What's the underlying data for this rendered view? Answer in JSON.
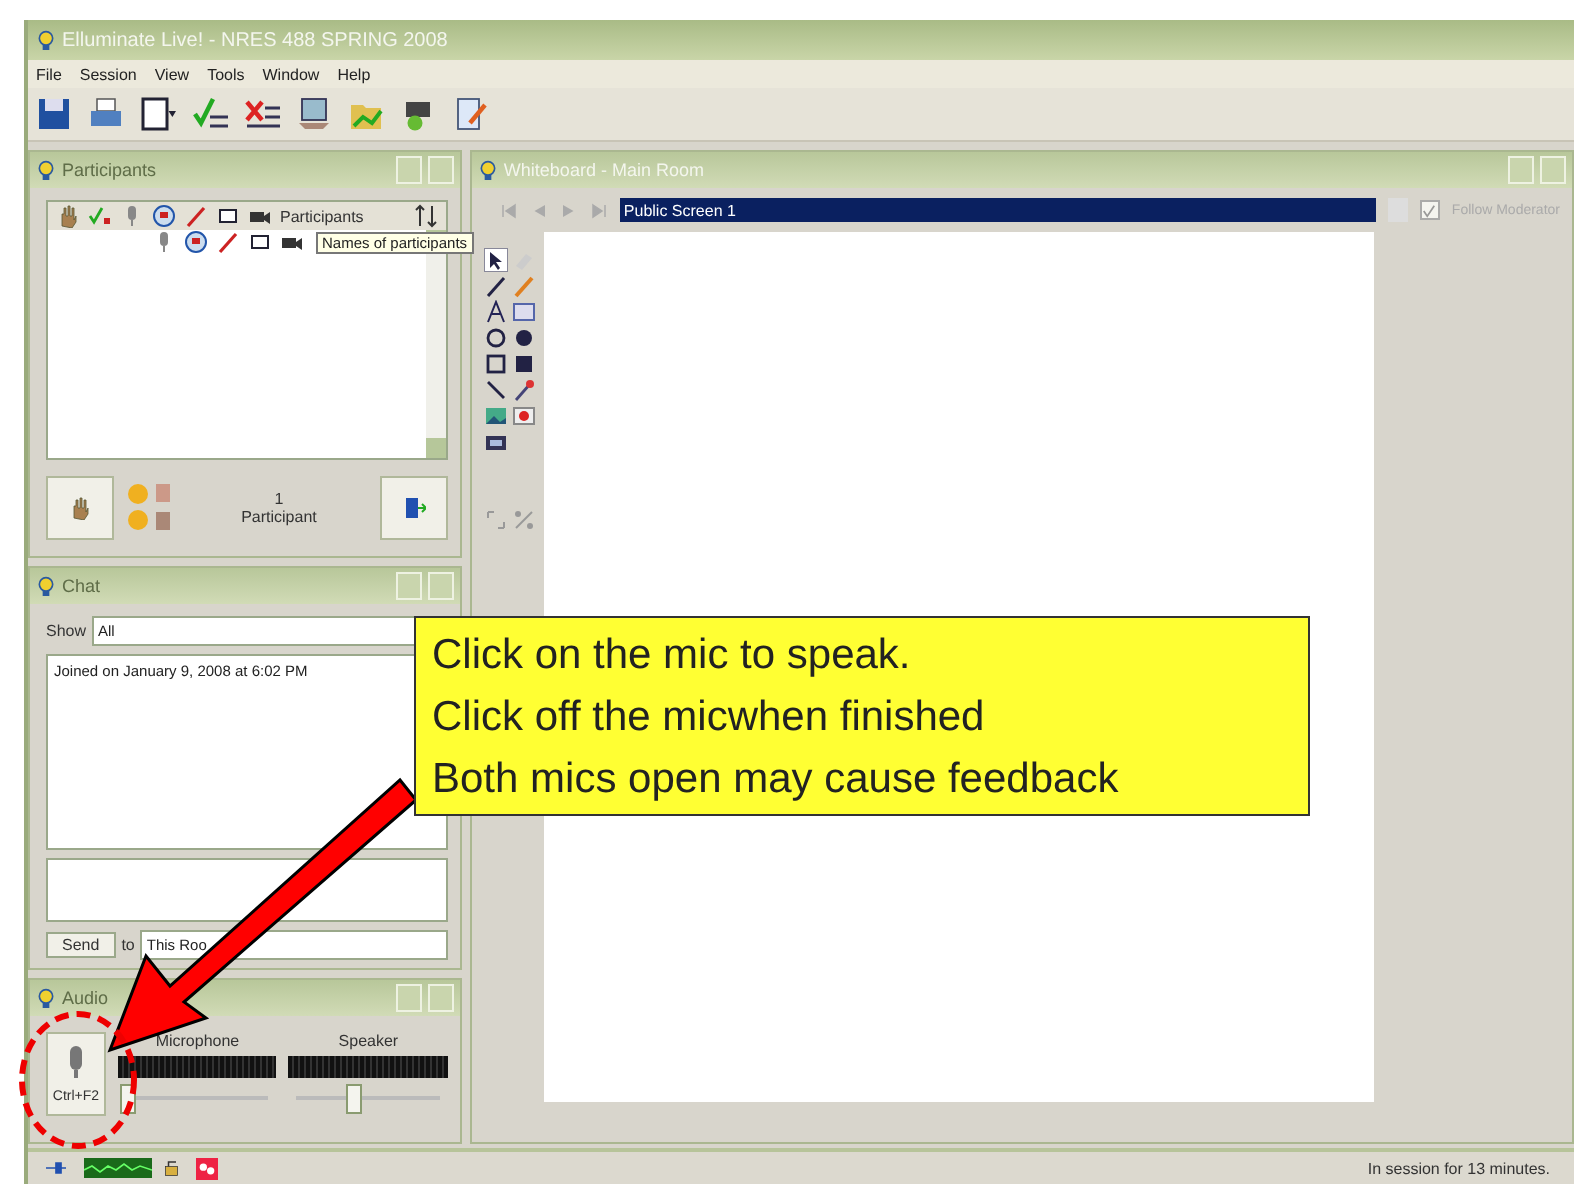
{
  "window": {
    "title": "Elluminate Live! - NRES 488 SPRING 2008"
  },
  "menu": [
    "File",
    "Session",
    "View",
    "Tools",
    "Window",
    "Help"
  ],
  "participants_panel": {
    "title": "Participants",
    "column_header": "Participants",
    "tooltip": "Names of participants",
    "count": "1",
    "count_label": "Participant"
  },
  "chat_panel": {
    "title": "Chat",
    "show_label": "Show",
    "show_value": "All",
    "messages": [
      "Joined on January 9, 2008 at 6:02 PM"
    ],
    "send_button": "Send",
    "to_label": "to",
    "to_value": "This Roo"
  },
  "audio_panel": {
    "title": "Audio",
    "mic_button": "Ctrl+F2",
    "meters": [
      {
        "label": "Microphone",
        "level": 0.0
      },
      {
        "label": "Speaker",
        "level": 0.38
      }
    ]
  },
  "whiteboard": {
    "title": "Whiteboard - Main Room",
    "screen": "Public Screen 1",
    "follow_moderator": {
      "label": "Follow Moderator",
      "checked": true
    }
  },
  "status_bar": {
    "text": "In session for 13 minutes."
  },
  "callout": {
    "lines": [
      "Click on the mic to speak.",
      "Click off the micwhen finished",
      "Both mics open may cause feedback"
    ]
  }
}
